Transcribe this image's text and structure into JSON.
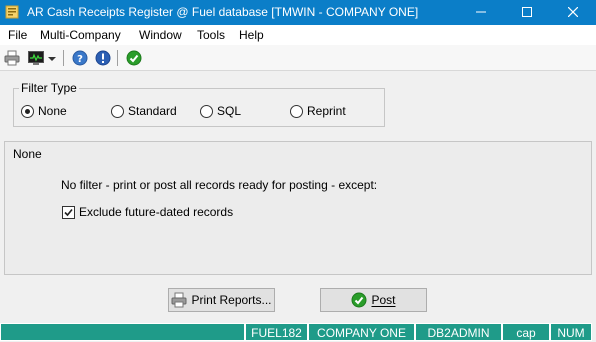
{
  "window": {
    "title": "AR Cash Receipts Register @ Fuel database [TMWIN - COMPANY ONE]",
    "minimize_glyph": "—",
    "close_glyph": "✕"
  },
  "menu": [
    "File",
    "Multi-Company",
    "Window",
    "Tools",
    "Help"
  ],
  "toolbar": {
    "icons": [
      "printer-icon",
      "monitor-icon",
      "dropdown-arrow-icon",
      "help-icon",
      "info-icon",
      "checkmark-icon"
    ]
  },
  "filter_type": {
    "legend": "Filter Type",
    "options": [
      {
        "label": "None",
        "selected": true
      },
      {
        "label": "Standard",
        "selected": false
      },
      {
        "label": "SQL",
        "selected": false
      },
      {
        "label": "Reprint",
        "selected": false
      }
    ]
  },
  "panel": {
    "title": "None",
    "message": "No filter - print or post all records ready for posting - except:",
    "checkbox_label": "Exclude future-dated records",
    "checkbox_checked": true
  },
  "buttons": {
    "print_reports": "Print Reports...",
    "post": "Post"
  },
  "status": [
    "FUEL182",
    "COMPANY ONE",
    "DB2ADMIN",
    "cap",
    "NUM"
  ],
  "colors": {
    "titlebar": "#0b7ec8",
    "status": "#1f9b89",
    "accent_green": "#2a9d2a"
  }
}
